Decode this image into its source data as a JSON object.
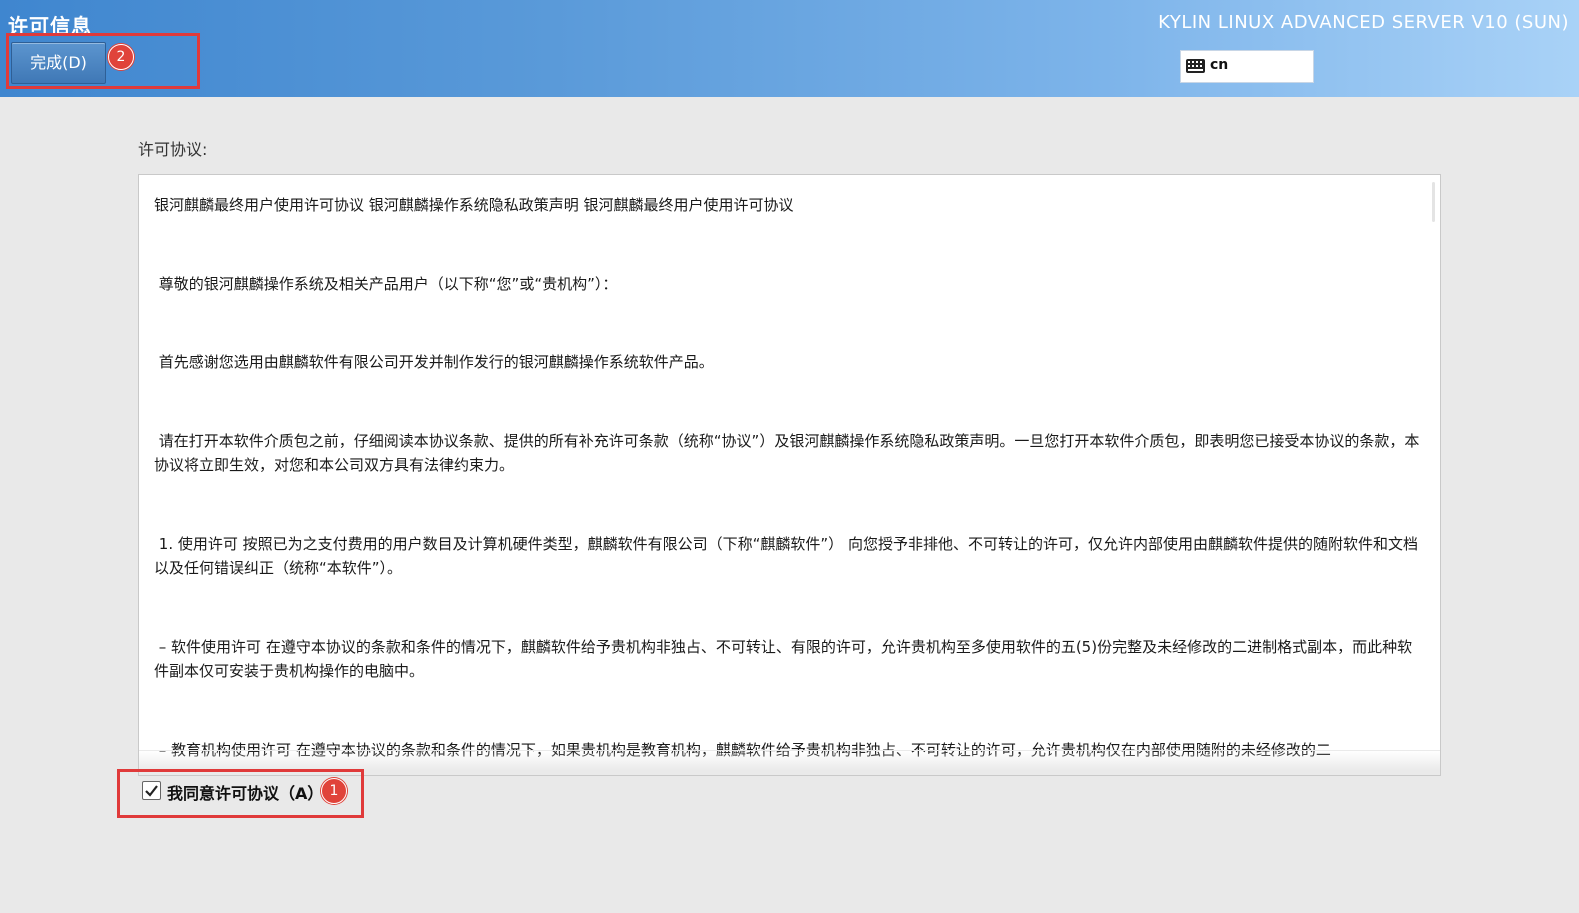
{
  "header": {
    "title": "许可信息",
    "done_button": "完成(D)",
    "product": "KYLIN LINUX ADVANCED SERVER V10 (SUN)",
    "keyboard_layout": "cn",
    "keyboard_icon": "keyboard-icon"
  },
  "license": {
    "label": "许可协议:",
    "paragraphs": [
      "银河麒麟最终用户使用许可协议 银河麒麟操作系统隐私政策声明 银河麒麟最终用户使用许可协议",
      " 尊敬的银河麒麟操作系统及相关产品用户（以下称“您”或“贵机构”）：",
      " 首先感谢您选用由麒麟软件有限公司开发并制作发行的银河麒麟操作系统软件产品。",
      " 请在打开本软件介质包之前，仔细阅读本协议条款、提供的所有补充许可条款（统称“协议”）及银河麒麟操作系统隐私政策声明。一旦您打开本软件介质包，即表明您已接受本协议的条款，本协议将立即生效，对您和本公司双方具有法律约束力。",
      " 1. 使用许可 按照已为之支付费用的用户数目及计算机硬件类型，麒麟软件有限公司（下称“麒麟软件”） 向您授予非排他、不可转让的许可，仅允许内部使用由麒麟软件提供的随附软件和文档以及任何错误纠正（统称“本软件”）。",
      " – 软件使用许可 在遵守本协议的条款和条件的情况下，麒麟软件给予贵机构非独占、不可转让、有限的许可，允许贵机构至多使用软件的五(5)份完整及未经修改的二进制格式副本，而此种软件副本仅可安装于贵机构操作的电脑中。",
      " – 教育机构使用许可 在遵守本协议的条款和条件的情况下，如果贵机构是教育机构，麒麟软件给予贵机构非独占、不可转让的许可，允许贵机构仅在内部使用随附的未经修改的二"
    ]
  },
  "agree": {
    "label": "我同意许可协议（A）",
    "checked": true
  },
  "annotations": {
    "badge1": "1",
    "badge2": "2",
    "color": "#e03a3a"
  }
}
